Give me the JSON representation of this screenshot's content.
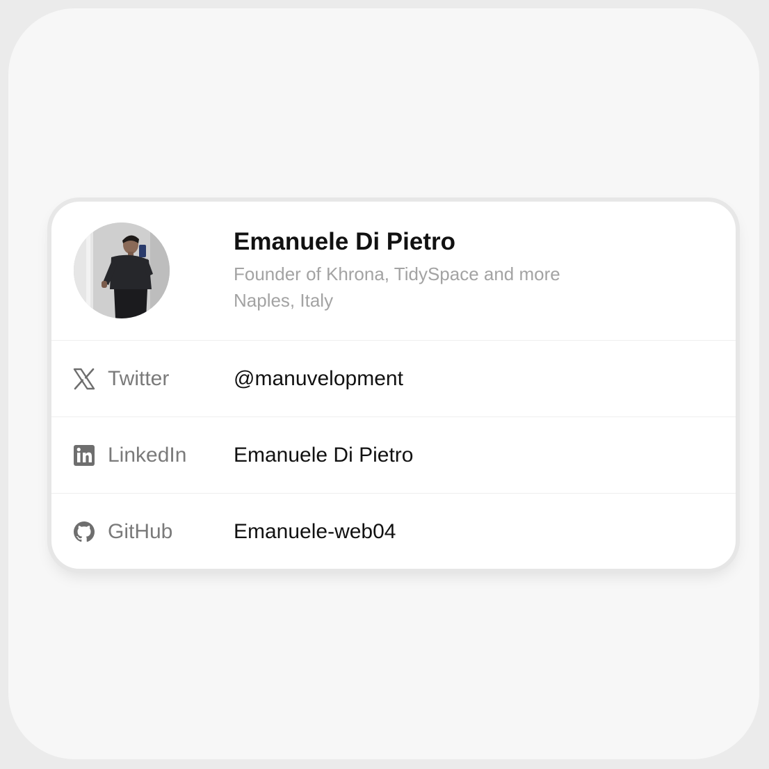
{
  "profile": {
    "name": "Emanuele Di Pietro",
    "bio": "Founder of Khrona, TidySpace and more",
    "location": "Naples, Italy",
    "avatar": "profile-photo"
  },
  "links": [
    {
      "icon": "x-icon",
      "label": "Twitter",
      "value": "@manuvelopment"
    },
    {
      "icon": "linkedin-icon",
      "label": "LinkedIn",
      "value": "Emanuele Di Pietro"
    },
    {
      "icon": "github-icon",
      "label": "GitHub",
      "value": "Emanuele-web04"
    }
  ],
  "colors": {
    "background": "#f7f7f7",
    "card": "#ffffff",
    "primary_text": "#111111",
    "secondary_text": "#a3a3a3",
    "label_text": "#7a7a7a",
    "divider": "#eeeeee"
  }
}
